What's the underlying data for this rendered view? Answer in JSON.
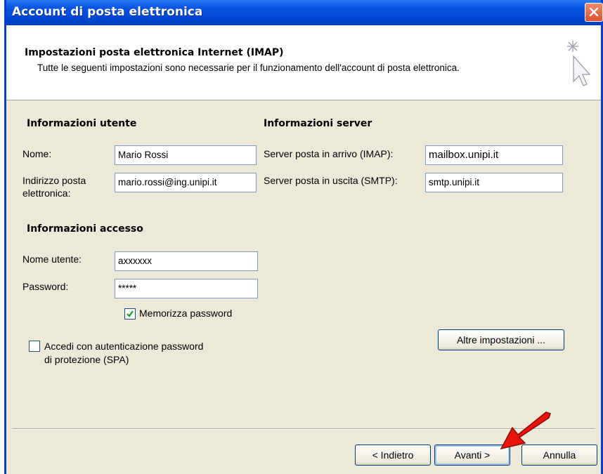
{
  "window": {
    "title": "Account di posta elettronica"
  },
  "header": {
    "title": "Impostazioni posta elettronica Internet (IMAP)",
    "description": "Tutte le seguenti impostazioni sono necessarie per il funzionamento dell'account di posta elettronica."
  },
  "user_info": {
    "title": "Informazioni utente",
    "name_label": "Nome:",
    "name_value": "Mario Rossi",
    "email_label": "Indirizzo posta elettronica:",
    "email_value": "mario.rossi@ing.unipi.it"
  },
  "server_info": {
    "title": "Informazioni server",
    "incoming_label": "Server posta in arrivo (IMAP):",
    "incoming_value": "mailbox.unipi.it",
    "outgoing_label": "Server posta in uscita (SMTP):",
    "outgoing_value": "smtp.unipi.it"
  },
  "login_info": {
    "title": "Informazioni accesso",
    "username_label": "Nome utente:",
    "username_value": "axxxxxx",
    "password_label": "Password:",
    "password_value": "*****",
    "remember_label": "Memorizza password",
    "remember_checked": true,
    "spa_label_1": "Accedi con autenticazione password",
    "spa_label_2": "di protezione (SPA)",
    "spa_checked": false
  },
  "buttons": {
    "more_settings": "Altre impostazioni ...",
    "back": "< Indietro",
    "next": "Avanti >",
    "cancel": "Annulla"
  },
  "colors": {
    "titlebar": "#0148d6",
    "dialog_bg": "#ece9d8",
    "check_green": "#21a121",
    "arrow_red": "#e8140c"
  }
}
